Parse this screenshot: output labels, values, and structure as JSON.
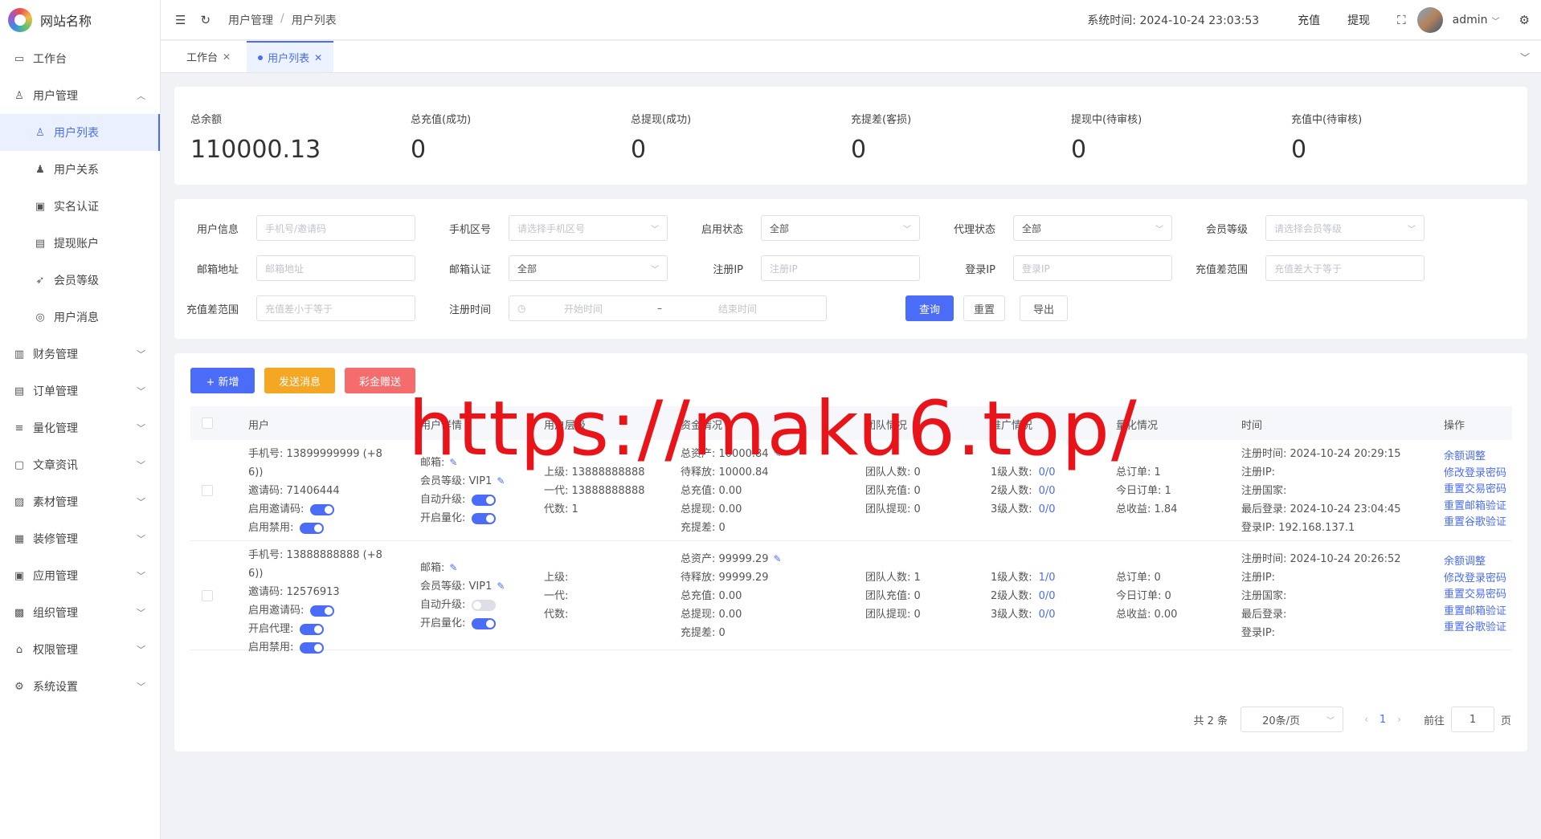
{
  "brand": {
    "site_name": "网站名称"
  },
  "sidebar": {
    "items": [
      {
        "label": "工作台",
        "icon": "monitor-icon",
        "glyph": "▭"
      },
      {
        "label": "用户管理",
        "icon": "user-icon",
        "glyph": "♙",
        "expanded": true
      }
    ],
    "sub": [
      {
        "label": "用户列表",
        "icon": "user-list-icon",
        "glyph": "♙",
        "active": true
      },
      {
        "label": "用户关系",
        "icon": "user-relation-icon",
        "glyph": "♟"
      },
      {
        "label": "实名认证",
        "icon": "id-card-icon",
        "glyph": "▣"
      },
      {
        "label": "提现账户",
        "icon": "folder-icon",
        "glyph": "▤"
      },
      {
        "label": "会员等级",
        "icon": "rocket-icon",
        "glyph": "➶"
      },
      {
        "label": "用户消息",
        "icon": "message-icon",
        "glyph": "◎"
      }
    ],
    "groups": [
      {
        "label": "财务管理",
        "icon": "chart-icon",
        "glyph": "▥"
      },
      {
        "label": "订单管理",
        "icon": "order-icon",
        "glyph": "▤"
      },
      {
        "label": "量化管理",
        "icon": "quant-icon",
        "glyph": "≡"
      },
      {
        "label": "文章资讯",
        "icon": "article-icon",
        "glyph": "▢"
      },
      {
        "label": "素材管理",
        "icon": "image-icon",
        "glyph": "▨"
      },
      {
        "label": "装修管理",
        "icon": "decor-icon",
        "glyph": "▦"
      },
      {
        "label": "应用管理",
        "icon": "app-icon",
        "glyph": "▣"
      },
      {
        "label": "组织管理",
        "icon": "org-icon",
        "glyph": "▩"
      },
      {
        "label": "权限管理",
        "icon": "lock-icon",
        "glyph": "⌂"
      },
      {
        "label": "系统设置",
        "icon": "gear-icon",
        "glyph": "⚙"
      }
    ]
  },
  "header": {
    "breadcrumb": [
      "用户管理",
      "用户列表"
    ],
    "system_time": "系统时间: 2024-10-24 23:03:53",
    "recharge": "充值",
    "withdraw": "提现",
    "user": "admin"
  },
  "tabs": [
    {
      "label": "工作台",
      "active": false
    },
    {
      "label": "用户列表",
      "active": true
    }
  ],
  "stats": [
    {
      "label": "总余额",
      "value": "110000.13"
    },
    {
      "label": "总充值(成功)",
      "value": "0"
    },
    {
      "label": "总提现(成功)",
      "value": "0"
    },
    {
      "label": "充提差(客损)",
      "value": "0"
    },
    {
      "label": "提现中(待审核)",
      "value": "0"
    },
    {
      "label": "充值中(待审核)",
      "value": "0"
    }
  ],
  "filters": {
    "user_info": {
      "label": "用户信息",
      "placeholder": "手机号/邀请码"
    },
    "phone_area": {
      "label": "手机区号",
      "placeholder": "请选择手机区号"
    },
    "enable_status": {
      "label": "启用状态",
      "value": "全部"
    },
    "agent_status": {
      "label": "代理状态",
      "value": "全部"
    },
    "member_level": {
      "label": "会员等级",
      "placeholder": "请选择会员等级"
    },
    "email": {
      "label": "邮箱地址",
      "placeholder": "邮箱地址"
    },
    "email_verify": {
      "label": "邮箱认证",
      "value": "全部"
    },
    "reg_ip": {
      "label": "注册IP",
      "placeholder": "注册IP"
    },
    "login_ip": {
      "label": "登录IP",
      "placeholder": "登录IP"
    },
    "diff_min": {
      "label": "充值差范围",
      "placeholder": "充值差大于等于"
    },
    "diff_max": {
      "label": "充值差范围",
      "placeholder": "充值差小于等于"
    },
    "reg_time": {
      "label": "注册时间",
      "start": "开始时间",
      "sep": "–",
      "end": "结束时间"
    },
    "query": "查询",
    "reset": "重置",
    "export": "导出"
  },
  "toolbar": {
    "add": "+ 新增",
    "send_message": "发送消息",
    "bonus": "彩金赠送",
    "colors": {
      "add": "#4a6cf7",
      "send_message": "#f5a623",
      "bonus": "#f56c6c"
    }
  },
  "table": {
    "columns": [
      "用户",
      "用户详情",
      "用户层级",
      "资金情况",
      "团队情况",
      "推广情况",
      "量化情况",
      "时间",
      "操作"
    ],
    "rows": [
      {
        "user": [
          "手机号: 13899999999 (+8",
          "6))",
          "邀请码: 71406444"
        ],
        "user_toggles": [
          {
            "label": "启用邀请码:",
            "on": true
          },
          {
            "label": "启用禁用:",
            "on": true
          }
        ],
        "detail": [
          {
            "text": "邮箱:",
            "edit": true
          },
          {
            "text": "会员等级: VIP1",
            "edit": true
          }
        ],
        "detail_toggles": [
          {
            "label": "自动升级:",
            "on": true
          },
          {
            "label": "开启量化:",
            "on": true
          }
        ],
        "level": [
          "上级: 13888888888",
          "一代: 13888888888",
          "代数: 1"
        ],
        "funds": [
          "总资产: 10000.84",
          "待释放: 10000.84",
          "总充值: 0.00",
          "总提现: 0.00",
          "充提差:  0"
        ],
        "team": [
          "团队人数: 0",
          "团队充值: 0",
          "团队提现: 0"
        ],
        "promo": [
          {
            "label": "1级人数:",
            "value": "0/0"
          },
          {
            "label": "2级人数:",
            "value": "0/0"
          },
          {
            "label": "3级人数:",
            "value": "0/0"
          }
        ],
        "quant": [
          "总订单: 1",
          "今日订单: 1",
          "总收益: 1.84"
        ],
        "time": [
          "注册时间: 2024-10-24 20:29:15",
          "注册IP:",
          "注册国家:",
          "最后登录: 2024-10-24 23:04:45",
          "登录IP: 192.168.137.1"
        ],
        "actions": [
          "余额调整",
          "修改登录密码",
          "重置交易密码",
          "重置邮箱验证",
          "重置谷歌验证"
        ]
      },
      {
        "user": [
          "手机号: 13888888888 (+8",
          "6))",
          "邀请码: 12576913"
        ],
        "user_toggles": [
          {
            "label": "启用邀请码:",
            "on": true
          },
          {
            "label": "开启代理:",
            "on": true
          },
          {
            "label": "启用禁用:",
            "on": true
          }
        ],
        "detail": [
          {
            "text": "邮箱:",
            "edit": true
          },
          {
            "text": "会员等级: VIP1",
            "edit": true
          }
        ],
        "detail_toggles": [
          {
            "label": "自动升级:",
            "on": false
          },
          {
            "label": "开启量化:",
            "on": true
          }
        ],
        "level": [
          "上级:",
          "一代:",
          "代数:"
        ],
        "funds": [
          "总资产: 99999.29",
          "待释放: 99999.29",
          "总充值: 0.00",
          "总提现: 0.00",
          "充提差:  0"
        ],
        "team": [
          "团队人数: 1",
          "团队充值: 0",
          "团队提现: 0"
        ],
        "promo": [
          {
            "label": "1级人数:",
            "value": "1/0"
          },
          {
            "label": "2级人数:",
            "value": "0/0"
          },
          {
            "label": "3级人数:",
            "value": "0/0"
          }
        ],
        "quant": [
          "总订单: 0",
          "今日订单: 0",
          "总收益: 0.00"
        ],
        "time": [
          "注册时间: 2024-10-24 20:26:52",
          "注册IP:",
          "注册国家:",
          "最后登录:",
          "登录IP:"
        ],
        "actions": [
          "余额调整",
          "修改登录密码",
          "重置交易密码",
          "重置邮箱验证",
          "重置谷歌验证"
        ]
      }
    ]
  },
  "pagination": {
    "total": "共 2 条",
    "page_size": "20条/页",
    "current": "1",
    "goto_label": "前往",
    "goto_value": "1",
    "page_suffix": "页"
  },
  "watermark": "https://maku6.top/"
}
